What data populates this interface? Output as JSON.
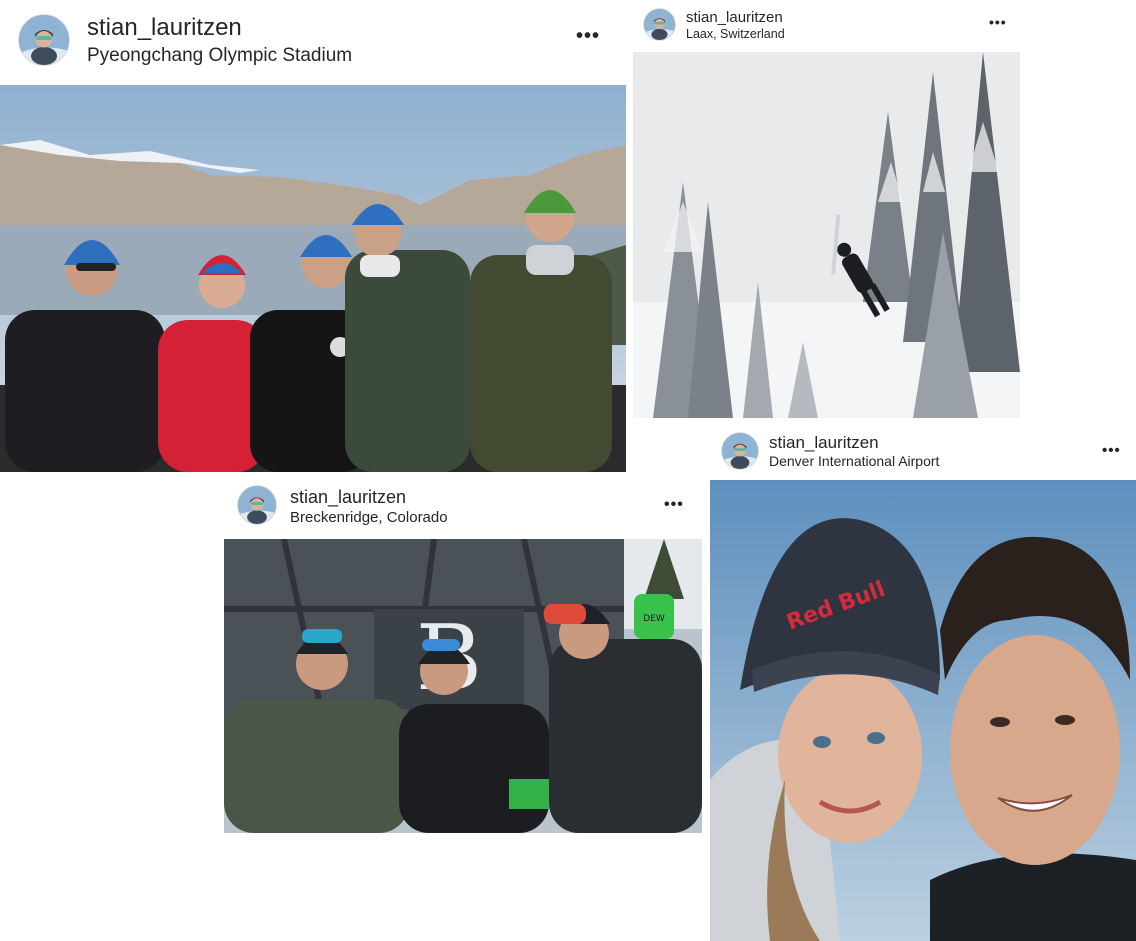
{
  "posts": [
    {
      "username": "stian_lauritzen",
      "location": "Pyeongchang Olympic Stadium",
      "more_label": "•••"
    },
    {
      "username": "stian_lauritzen",
      "location": "Laax, Switzerland",
      "more_label": "•••"
    },
    {
      "username": "stian_lauritzen",
      "location": "Breckenridge, Colorado",
      "more_label": "•••"
    },
    {
      "username": "stian_lauritzen",
      "location": "Denver International Airport",
      "more_label": "•••"
    }
  ],
  "photo_overlays": {
    "beanie_brand": "Red Bull",
    "letter_on_banner": "B",
    "glove_brand": "DEW"
  },
  "colors": {
    "text": "#262626",
    "background": "#ffffff"
  }
}
